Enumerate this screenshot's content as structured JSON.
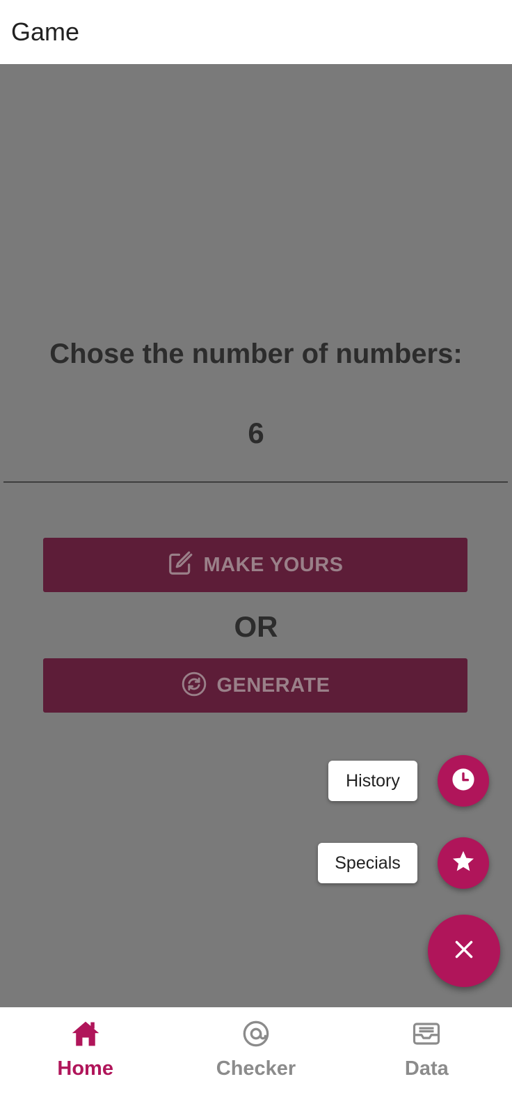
{
  "app_bar": {
    "title": "Game"
  },
  "main": {
    "prompt": "Chose the number of numbers:",
    "count_value": "6",
    "make_button": {
      "label": "MAKE YOURS",
      "icon": "edit-icon"
    },
    "or_text": "OR",
    "generate_button": {
      "label": "GENERATE",
      "icon": "refresh-icon"
    }
  },
  "speed_dial": {
    "history": {
      "label": "History",
      "icon": "clock-icon"
    },
    "specials": {
      "label": "Specials",
      "icon": "star-icon"
    },
    "close": {
      "icon": "close-icon"
    }
  },
  "bottom_nav": {
    "items": [
      {
        "label": "Home",
        "icon": "home-icon",
        "active": true
      },
      {
        "label": "Checker",
        "icon": "at-sign-icon",
        "active": false
      },
      {
        "label": "Data",
        "icon": "inbox-icon",
        "active": false
      }
    ]
  },
  "colors": {
    "accent": "#b0155a",
    "button_dimmed": "#5d1d38",
    "scrim": "rgba(0,0,0,0.52)",
    "inactive_nav": "#8b8b8b"
  }
}
